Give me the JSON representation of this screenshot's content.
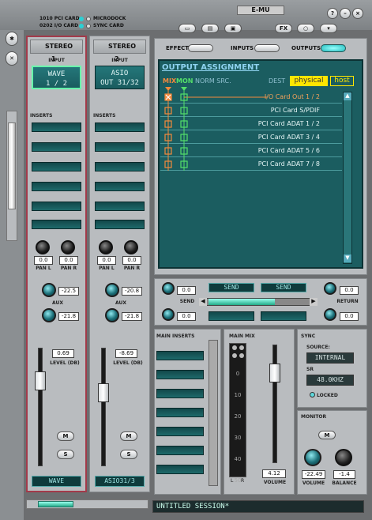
{
  "header": {
    "pci_card": "1010 PCI CARD",
    "io_card": "0202 I/O CARD",
    "microdock": "MICRODOCK",
    "sync_card": "SYNC CARD",
    "brand": "E-MU"
  },
  "toolbar": {
    "fx": "FX"
  },
  "strips": [
    {
      "label": "STEREO",
      "num": "1",
      "input_label": "INPUT",
      "input_l1": "WAVE",
      "input_l2": "1 / 2",
      "inserts": "INSERTS",
      "pan_l": "0.0",
      "pan_r": "0.0",
      "pan_l_label": "PAN L",
      "pan_r_label": "PAN R",
      "aux1": "-22.5",
      "aux2": "-21.8",
      "aux_label": "AUX",
      "level": "0.69",
      "level_label": "LEVEL (DB)",
      "mute": "M",
      "solo": "S",
      "name": "WAVE"
    },
    {
      "label": "STEREO",
      "num": "2",
      "input_label": "INPUT",
      "input_l1": "ASIO",
      "input_l2": "OUT 31/32",
      "inserts": "INSERTS",
      "pan_l": "0.0",
      "pan_r": "0.0",
      "pan_l_label": "PAN L",
      "pan_r_label": "PAN R",
      "aux1": "-20.8",
      "aux2": "-21.8",
      "aux_label": "AUX",
      "level": "-8.69",
      "level_label": "LEVEL (DB)",
      "mute": "M",
      "solo": "S",
      "name": "ASIO31/3"
    }
  ],
  "tabs": {
    "effect": "EFFECT",
    "inputs": "INPUTS",
    "outputs": "OUTPUTS"
  },
  "output": {
    "title": "OUTPUT ASSIGNMENT",
    "mix": "MIX",
    "mon": "MON",
    "norm": "NORM SRC.",
    "dest": "DEST",
    "physical": "physical",
    "host": "host",
    "rows": [
      "I/O Card Out 1 / 2",
      "PCI Card S/PDIF",
      "PCI Card ADAT 1 / 2",
      "PCI Card ADAT 3 / 4",
      "PCI Card ADAT 5 / 6",
      "PCI Card ADAT 7 / 8"
    ]
  },
  "send": {
    "label": "SEND",
    "v1": "0.0",
    "v2": "0.0",
    "send_a": "SEND",
    "send_b": "SEND"
  },
  "ret": {
    "label": "RETURN",
    "v1": "0.0",
    "v2": "0.0"
  },
  "main_inserts": "MAIN INSERTS",
  "main_mix": {
    "label": "MAIN MIX",
    "ticks": [
      "0",
      "10",
      "20",
      "30",
      "40",
      "50"
    ],
    "l": "L",
    "r": "R",
    "volume": "4.12",
    "volume_label": "VOLUME"
  },
  "sync": {
    "label": "SYNC",
    "source_label": "SOURCE:",
    "source": "INTERNAL",
    "sr_label": "SR",
    "sr": "48.0KHZ",
    "locked": "LOCKED"
  },
  "monitor": {
    "label": "MONITOR",
    "mute": "M",
    "volume": "-22.49",
    "balance": "-1.4",
    "volume_label": "VOLUME",
    "balance_label": "BALANCE"
  },
  "session": "UNTITLED SESSION*"
}
